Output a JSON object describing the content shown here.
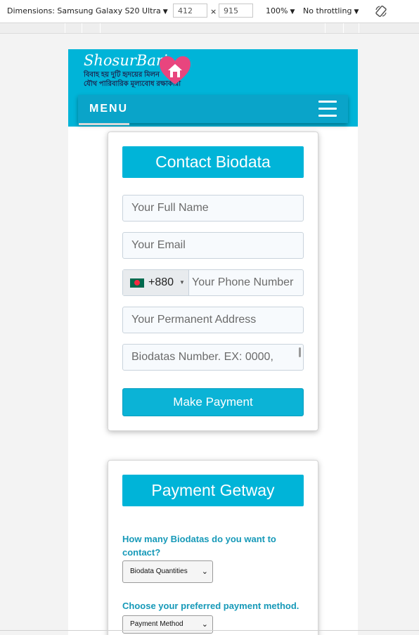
{
  "devtools": {
    "dimensions_label": "Dimensions: Samsung Galaxy S20 Ultra",
    "width": "412",
    "times": "×",
    "height": "915",
    "zoom": "100%",
    "throttling": "No throttling",
    "caret": "▼"
  },
  "site": {
    "logo_name": "ShosurBari",
    "logo_line1": "বিবাহ হয় দুটি হৃদয়ের মিলন",
    "logo_line2": "যৌথ পারিবারিক মূল্যবোধ রক্ষাকারী"
  },
  "nav": {
    "menu_label": "MENU"
  },
  "contact_card": {
    "title": "Contact Biodata",
    "name_placeholder": "Your Full Name",
    "email_placeholder": "Your Email",
    "dial_code": "+880",
    "phone_placeholder": "Your Phone Number",
    "address_placeholder": "Your Permanent Address",
    "biodata_placeholder": "Biodatas Number. EX: 0000,",
    "submit_label": "Make Payment"
  },
  "payment_card": {
    "title": "Payment Getway",
    "question_quantity": "How many Biodatas do you want to contact?",
    "quantity_select": "Biodata Quantities",
    "question_method": "Choose your preferred payment method.",
    "method_select": "Payment Method"
  },
  "colors": {
    "accent": "#00b4d8",
    "menubar": "#0aa4c9",
    "question_text": "#1699b8"
  }
}
